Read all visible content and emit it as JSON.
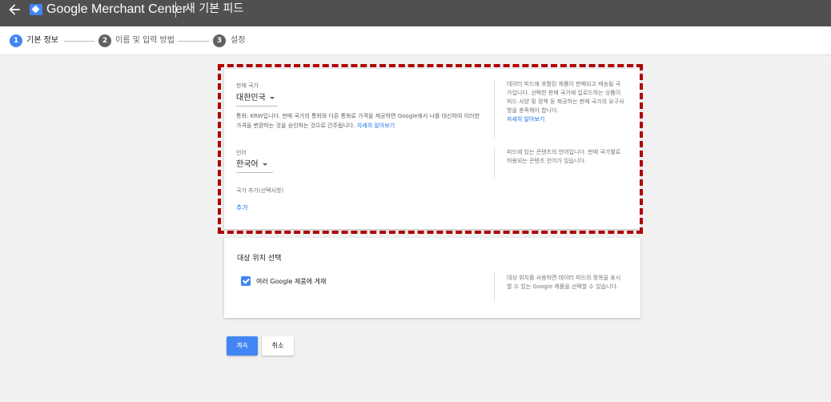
{
  "appbar": {
    "brand": "Google Merchant Center",
    "page_title": "새 기본 피드"
  },
  "stepper": {
    "steps": [
      {
        "number": "1",
        "label": "기본 정보",
        "active": true
      },
      {
        "number": "2",
        "label": "이름 및 입력 방법",
        "active": false
      },
      {
        "number": "3",
        "label": "설정",
        "active": false
      }
    ]
  },
  "basic_info": {
    "country_label": "판매 국가",
    "country_value": "대한민국",
    "currency_note": "통화: KRW입니다. 판매 국가의 통화와 다른 통화로 가격을 제공하면 Google에서 나를 대신하여 이러한 가격을 변환하는 것을 승인하는 것으로 간주됩니다.",
    "currency_note_link": "자세히 알아보기",
    "country_help": "데이터 피드에 포함된 제품이 판매되고 배송될 국가입니다. 선택한 판매 국가에 업로드하는 상품이 피드 사양 및 정책 등 제공하는 판매 국가의 요구사항을 충족해야 합니다.",
    "country_help_link": "자세히 알아보기",
    "language_label": "언어",
    "language_value": "한국어",
    "language_help": "피드에 있는 콘텐츠의 언어입니다. 판매 국가별로 허용되는 콘텐츠 언어가 있습니다.",
    "add_country_label": "국가 추가(선택사항)",
    "add_country_link": "추가"
  },
  "destinations": {
    "title": "대상 위치 선택",
    "checkbox_label": "여러 Google 제품에 게재",
    "checkbox_checked": true,
    "help": "대상 위치를 사용하면 데이터 피드의 항목을 표시할 수 있는 Google 제품을 선택할 수 있습니다."
  },
  "buttons": {
    "continue": "계속",
    "cancel": "취소"
  },
  "colors": {
    "accent": "#4285f4",
    "appbar": "#505050",
    "highlight": "#b00000"
  },
  "icons": {
    "back": "arrow-left-icon",
    "logo": "merchant-center-tag-icon",
    "checkbox": "check-icon"
  }
}
